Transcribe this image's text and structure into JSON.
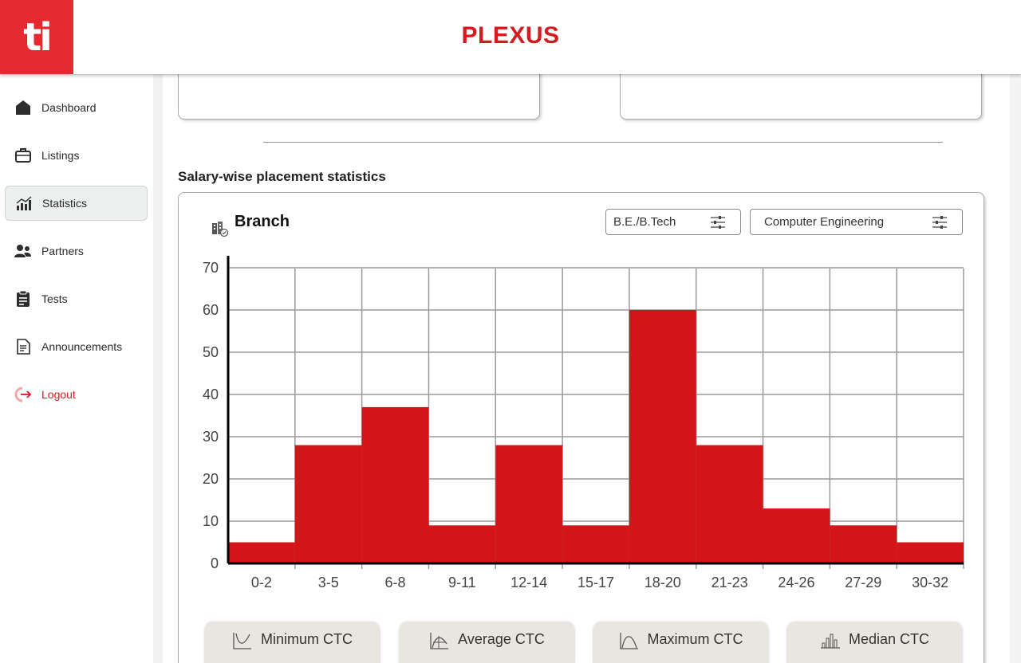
{
  "app": {
    "logo_text": "ti",
    "title": "PLEXUS",
    "brand_color": "#d31c1f"
  },
  "sidebar": {
    "items": [
      {
        "label": "Dashboard",
        "icon": "home-icon"
      },
      {
        "label": "Listings",
        "icon": "briefcase-icon"
      },
      {
        "label": "Statistics",
        "icon": "bar-chart-icon",
        "active": true
      },
      {
        "label": "Partners",
        "icon": "users-icon"
      },
      {
        "label": "Tests",
        "icon": "clipboard-icon"
      },
      {
        "label": "Announcements",
        "icon": "document-icon"
      },
      {
        "label": "Logout",
        "icon": "logout-icon"
      }
    ]
  },
  "section": {
    "title": "Salary-wise placement statistics"
  },
  "card": {
    "title": "Branch",
    "icon": "branch-icon",
    "filters": {
      "degree": "B.E./B.Tech",
      "branch": "Computer Engineering",
      "icon": "sliders-icon"
    }
  },
  "chart_data": {
    "type": "bar",
    "categories": [
      "0-2",
      "3-5",
      "6-8",
      "9-11",
      "12-14",
      "15-17",
      "18-20",
      "21-23",
      "24-26",
      "27-29",
      "30-32"
    ],
    "values": [
      5,
      28,
      37,
      9,
      28,
      9,
      60,
      28,
      13,
      9,
      5
    ],
    "yticks": [
      0,
      10,
      20,
      30,
      40,
      50,
      60,
      70
    ],
    "ylim": [
      0,
      70
    ],
    "grid": true,
    "bar_color": "#d31419"
  },
  "ctc_buttons": [
    {
      "label": "Minimum CTC",
      "icon": "min-curve-icon"
    },
    {
      "label": "Average CTC",
      "icon": "avg-curve-icon"
    },
    {
      "label": "Maximum CTC",
      "icon": "max-curve-icon"
    },
    {
      "label": "Median CTC",
      "icon": "median-bars-icon"
    }
  ]
}
